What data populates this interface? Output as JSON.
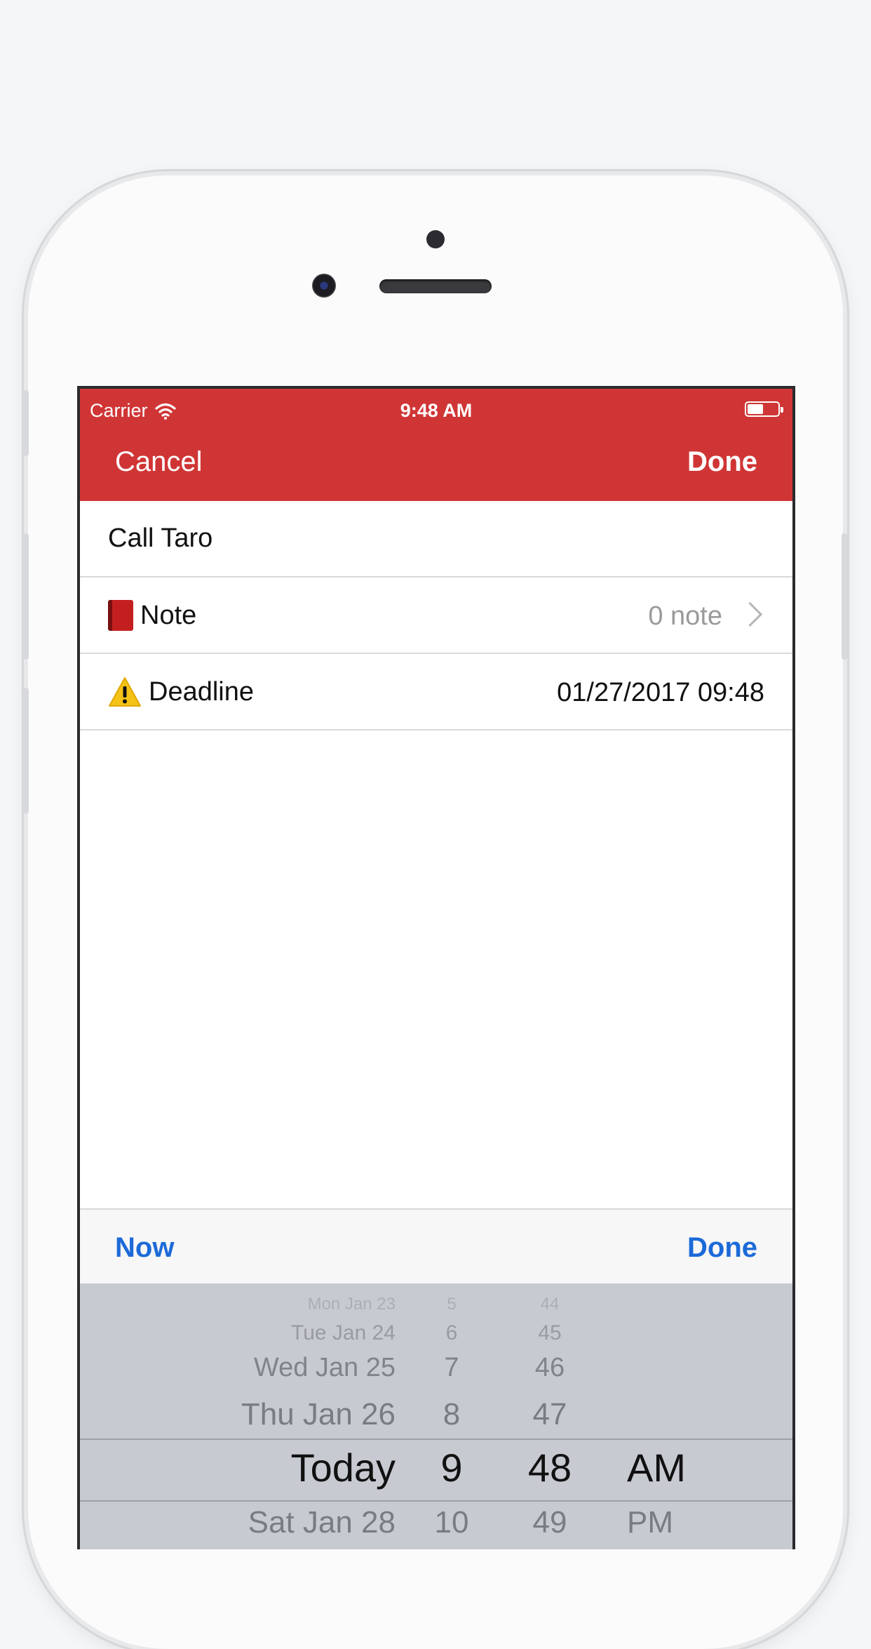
{
  "status_bar": {
    "carrier": "Carrier",
    "time": "9:48 AM"
  },
  "nav": {
    "cancel": "Cancel",
    "done": "Done"
  },
  "task": {
    "title": "Call Taro"
  },
  "rows": {
    "note": {
      "label": "Note",
      "value": "0 note"
    },
    "deadline": {
      "label": "Deadline",
      "value": "01/27/2017 09:48"
    }
  },
  "toolbar": {
    "now": "Now",
    "done": "Done"
  },
  "picker": {
    "dates": [
      "Mon Jan 23",
      "Tue Jan 24",
      "Wed Jan 25",
      "Thu Jan 26",
      "Today",
      "Sat Jan 28"
    ],
    "hours": [
      "5",
      "6",
      "7",
      "8",
      "9",
      "10"
    ],
    "minutes": [
      "44",
      "45",
      "46",
      "47",
      "48",
      "49"
    ],
    "ampm": [
      "AM",
      "PM"
    ],
    "selected_index": 4
  },
  "colors": {
    "navbar": "#d03535",
    "accent": "#1c6ad8"
  }
}
